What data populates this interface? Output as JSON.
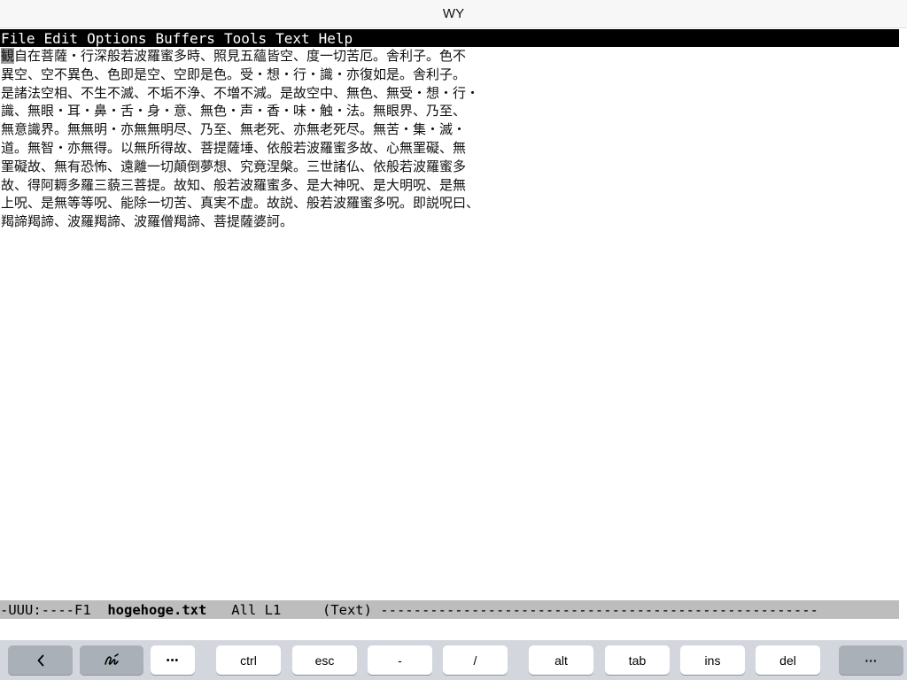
{
  "window": {
    "title": "WY"
  },
  "menubar": {
    "items": [
      "File",
      "Edit",
      "Options",
      "Buffers",
      "Tools",
      "Text",
      "Help"
    ]
  },
  "editor": {
    "cursor_char": "観",
    "first_line_rest": "自在菩薩・行深般若波羅蜜多時、照見五蘊皆空、度一切苦厄。舎利子。色不",
    "lines": [
      "異空、空不異色、色即是空、空即是色。受・想・行・識・亦復如是。舎利子。",
      "是諸法空相、不生不滅、不垢不浄、不増不減。是故空中、無色、無受・想・行・",
      "識、無眼・耳・鼻・舌・身・意、無色・声・香・味・触・法。無眼界、乃至、",
      "無意識界。無無明・亦無無明尽、乃至、無老死、亦無老死尽。無苦・集・滅・",
      "道。無智・亦無得。以無所得故、菩提薩埵、依般若波羅蜜多故、心無罣礙、無",
      "罣礙故、無有恐怖、遠離一切顛倒夢想、究竟涅槃。三世諸仏、依般若波羅蜜多",
      "故、得阿耨多羅三藐三菩提。故知、般若波羅蜜多、是大神呪、是大明呪、是無",
      "上呪、是無等等呪、能除一切苦、真実不虚。故説、般若波羅蜜多呪。即説呪曰、",
      "羯諦羯諦、波羅羯諦、波羅僧羯諦、菩提薩婆訶。"
    ]
  },
  "modeline": {
    "status": "-UUU:----F1  ",
    "buffer_name": "hogehoge.txt",
    "position": "   All L1     ",
    "mode": "(Text) ",
    "fill": "-----------------------------------------------------"
  },
  "keyboard": {
    "keys": {
      "more": "•••",
      "ctrl": "ctrl",
      "esc": "esc",
      "dash": "-",
      "slash": "/",
      "alt": "alt",
      "tab": "tab",
      "ins": "ins",
      "del": "del",
      "menu": "···"
    },
    "icons": {
      "back": "chevron-left-icon",
      "handwriting": "handwriting-icon"
    }
  }
}
